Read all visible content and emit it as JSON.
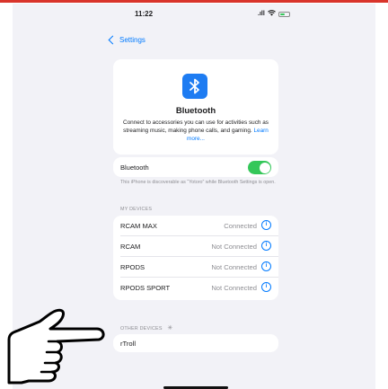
{
  "status_bar": {
    "time": "11:22",
    "signal": ".ıll",
    "wifi": "wifi"
  },
  "nav": {
    "back_label": "Settings"
  },
  "bluetooth_header": {
    "title": "Bluetooth",
    "description": "Connect to accessories you can use for activities such as streaming music, making phone calls, and gaming.",
    "learn_more": "Learn more..."
  },
  "bluetooth_toggle": {
    "label": "Bluetooth",
    "on": true
  },
  "discoverable_note": "This iPhone is discoverable as “Yotoro” while Bluetooth Settings is open.",
  "sections": {
    "my_devices": "MY DEVICES",
    "other_devices": "OTHER DEVICES"
  },
  "my_devices": [
    {
      "name": "RCAM MAX",
      "status": "Connected"
    },
    {
      "name": "RCAM",
      "status": "Not Connected"
    },
    {
      "name": "RPODS",
      "status": "Not Connected"
    },
    {
      "name": "RPODS SPORT",
      "status": "Not Connected"
    }
  ],
  "other_devices": [
    {
      "name": "rTroll"
    }
  ],
  "colors": {
    "accent": "#007aff",
    "toggle_on": "#34c759",
    "bt_tile": "#1e7cf2",
    "top_line": "#d9342b"
  }
}
